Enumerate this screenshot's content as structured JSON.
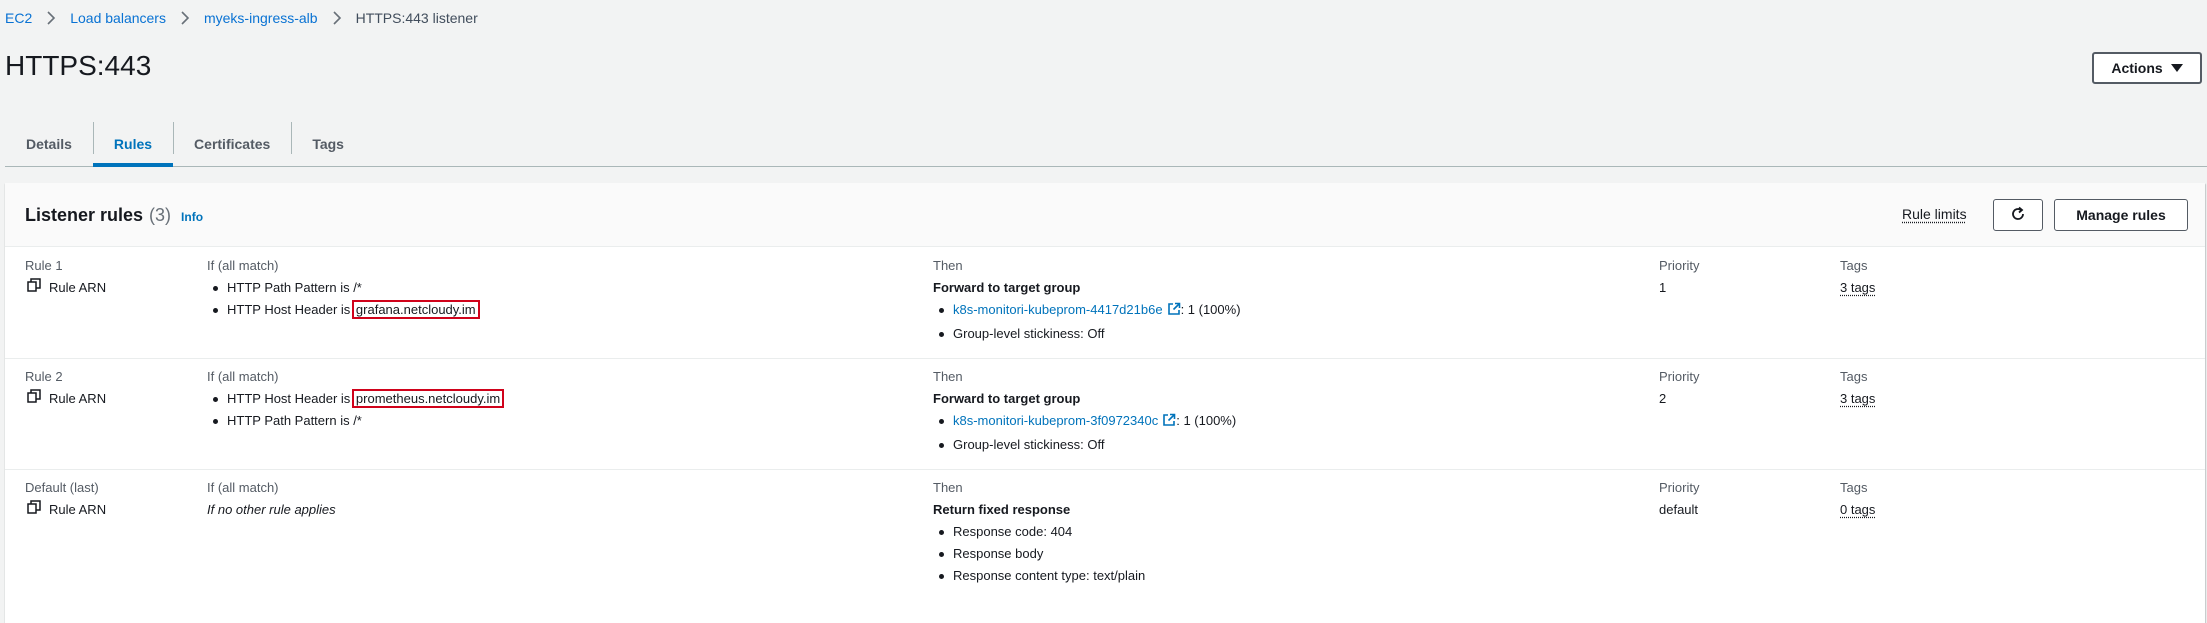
{
  "breadcrumb": {
    "items": [
      "EC2",
      "Load balancers",
      "myeks-ingress-alb"
    ],
    "current": "HTTPS:443 listener"
  },
  "page": {
    "title": "HTTPS:443",
    "actions_label": "Actions"
  },
  "tabs": [
    "Details",
    "Rules",
    "Certificates",
    "Tags"
  ],
  "active_tab": "Rules",
  "panel": {
    "title": "Listener rules",
    "count": "(3)",
    "info": "Info",
    "rule_limits": "Rule limits",
    "manage_rules": "Manage rules"
  },
  "columns": {
    "condition_header": "If (all match)",
    "then_header": "Then",
    "priority_header": "Priority",
    "tags_header": "Tags",
    "rule_arn_label": "Rule ARN"
  },
  "rules": [
    {
      "name": "Rule 1",
      "conditions": [
        {
          "text": "HTTP Path Pattern is /*",
          "value": ""
        },
        {
          "text": "HTTP Host Header is ",
          "value": "grafana.netcloudy.im"
        }
      ],
      "then_title": "Forward to target group",
      "target_group": "k8s-monitori-kubeprom-4417d21b6e",
      "target_weight": ": 1 (100%)",
      "stickiness": "Group-level stickiness: Off",
      "priority": "1",
      "tags": "3 tags"
    },
    {
      "name": "Rule 2",
      "conditions": [
        {
          "text": "HTTP Host Header is ",
          "value": "prometheus.netcloudy.im"
        },
        {
          "text": "HTTP Path Pattern is /*",
          "value": ""
        }
      ],
      "then_title": "Forward to target group",
      "target_group": "k8s-monitori-kubeprom-3f0972340c",
      "target_weight": ": 1 (100%)",
      "stickiness": "Group-level stickiness: Off",
      "priority": "2",
      "tags": "3 tags"
    },
    {
      "name": "Default (last)",
      "condition_text": "If no other rule applies",
      "then_title": "Return fixed response",
      "response_items": [
        "Response code: 404",
        "Response body",
        "Response content type: text/plain"
      ],
      "priority": "default",
      "tags": "0 tags"
    }
  ],
  "icons": {
    "breadcrumb_separator": "chevron-right-icon",
    "actions_caret": "caret-down-icon",
    "refresh": "refresh-icon",
    "copy": "copy-icon",
    "external": "external-link-icon"
  },
  "colors": {
    "link": "#0073bb",
    "highlight": "#d0021b",
    "background": "#f2f3f3"
  }
}
